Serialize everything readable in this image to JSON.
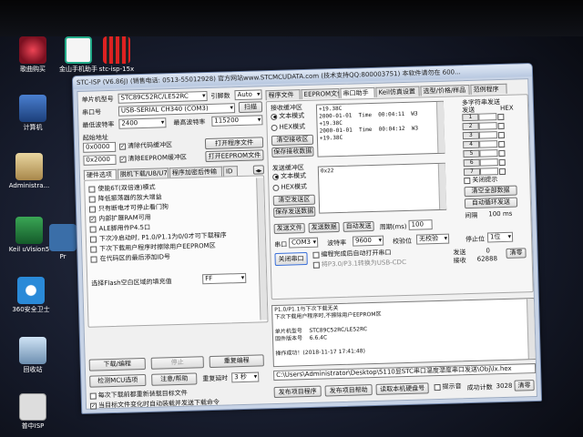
{
  "desktop": {
    "icons": [
      {
        "label": "歌曲购买",
        "icon": "music-icon"
      },
      {
        "label": "金山手机助手",
        "icon": "phone-assistant-icon"
      },
      {
        "label": "stc-isp-15x",
        "icon": "stc-isp-icon"
      },
      {
        "label": "计算机",
        "icon": "computer-icon"
      },
      {
        "label": "Administra...",
        "icon": "user-folder-icon"
      },
      {
        "label": "Keil uVision5",
        "icon": "keil-icon"
      },
      {
        "label": "Pr",
        "icon": "program-icon"
      },
      {
        "label": "360安全卫士",
        "icon": "security-icon"
      },
      {
        "label": "回收站",
        "icon": "recycle-bin-icon"
      },
      {
        "label": "普中ISP",
        "icon": "isp-icon"
      }
    ]
  },
  "window": {
    "title": "STC-ISP (V6.86J) (销售电话: 0513-55012928) 官方网站www.STCMCUDATA.com (技术支持QQ:800003751) 本软件请勿在 600...",
    "left": {
      "mcu_type_label": "单片机型号",
      "mcu_type_value": "STC89C52RC/LE52RC",
      "pin_label": "引脚数",
      "pin_value": "Auto",
      "port_label": "串口号",
      "port_value": "USB-SERIAL CH340 (COM3)",
      "scan_button": "扫描",
      "min_baud_label": "最低波特率",
      "min_baud_value": "2400",
      "max_baud_label": "最高波特率",
      "max_baud_value": "115200",
      "start_addr_label": "起始地址",
      "addr1": "0x0000",
      "clear_code_label": "清除代码缓冲区",
      "open_prog_button": "打开程序文件",
      "addr2": "0x2000",
      "clear_eeprom_label": "清除EEPROM缓冲区",
      "open_eeprom_button": "打开EEPROM文件",
      "tabs": [
        "硬件选项",
        "脱机下载/U8/U7",
        "程序加密后传输",
        "ID"
      ],
      "options": [
        {
          "label": "使能6T(双倍速)模式",
          "checked": false
        },
        {
          "label": "降低振荡器的放大增益",
          "checked": false
        },
        {
          "label": "只有断电才可停止看门狗",
          "checked": false
        },
        {
          "label": "内部扩展RAM可用",
          "checked": true
        },
        {
          "label": "ALE脚用作P4.5口",
          "checked": false
        },
        {
          "label": "下次冷启动时, P1.0/P1.1为0/0才可下载程序",
          "checked": false
        },
        {
          "label": "下次下载用户程序时擦除用户EEPROM区",
          "checked": false
        },
        {
          "label": "在代码区的最后添加ID号",
          "checked": false
        }
      ],
      "fill_label": "选择Flash空白区域的填充值",
      "fill_value": "FF",
      "download_button": "下载/编程",
      "stop_button": "停止",
      "reprogram_button": "重复编程",
      "check_mcu_button": "检测MCU选项",
      "help_button": "注意/帮助",
      "repeat_delay_label": "重复延时",
      "repeat_delay_value": "3 秒",
      "reload_label": "每次下载前都重新装载目标文件",
      "auto_send_label": "当目标文件变化时自动装载并发送下载命令"
    },
    "right": {
      "tabs": [
        "程序文件",
        "EEPROM文件",
        "串口助手",
        "Keil仿真设置",
        "选型/价格/样品",
        "范例程序"
      ],
      "recv_group": "接收缓冲区",
      "recv_text_mode": "文本模式",
      "recv_hex_mode": "HEX模式",
      "clear_recv_button": "清空接收区",
      "save_recv_button": "保存接收数据",
      "recv_lines": [
        "+19.38C",
        "2000-01-01  Time  00:04:11  W3",
        "+19.38C",
        "2000-01-01  Time  00:04:12  W3",
        "+19.38C"
      ],
      "multi_title": "多字符串发送",
      "multi_send_label": "发送",
      "multi_hex_label": "HEX",
      "multi_rows": [
        "1",
        "2",
        "3",
        "4",
        "5",
        "6",
        "7"
      ],
      "send_group": "发送缓冲区",
      "send_text_mode": "文本模式",
      "send_hex_mode": "HEX模式",
      "clear_send_button": "清空发送区",
      "save_send_button": "保存发送数据",
      "send_value": "0x22",
      "close_tip_label": "关闭提示",
      "clear_all_button": "清空全部数据",
      "auto_loop_button": "自动循环发送",
      "interval_label": "间隔",
      "interval_unit": "100 ms",
      "send_file_button": "发送文件",
      "send_data_button": "发送数据",
      "auto_send_button": "自动发送",
      "period_label": "周期(ms)",
      "period_value": "100",
      "port_label": "串口",
      "port_value": "COM3",
      "baud_label": "波特率",
      "baud_value": "9600",
      "parity_label": "校验位",
      "parity_value": "无校验",
      "stop_label": "停止位",
      "stop_value": "1位",
      "close_port_button": "关闭串口",
      "auto_open_label": "编程完成后自动打开串口",
      "p30_label": "将P3.0/P3.1转换为USB-CDC",
      "send_count_label": "发送",
      "send_count_value": "0",
      "recv_count_label": "接收",
      "recv_count_value": "62888",
      "clear_count_button": "清零",
      "log_lines": [
        "P1.0/P1.1与下次下载无关",
        "下次下载用户程序时,不擦除用户EEPROM区",
        "",
        "单片机型号    STC89C52RC/LE52RC",
        "固件版本号    6.6.4C",
        "",
        "操作成功！(2018-11-17 17:41:48)"
      ],
      "path_value": "C:\\Users\\Administrator\\Desktop\\5110显STC串口温度湿度串口发送\\Obj\\lx.hex",
      "publish_button": "发布项目程序",
      "publish_help_button": "发布项目帮助",
      "read_disk_button": "读取本机硬盘号",
      "prompt_label": "提示音",
      "success_label": "成功计数",
      "success_value": "3028",
      "clear_success_button": "清零"
    }
  }
}
